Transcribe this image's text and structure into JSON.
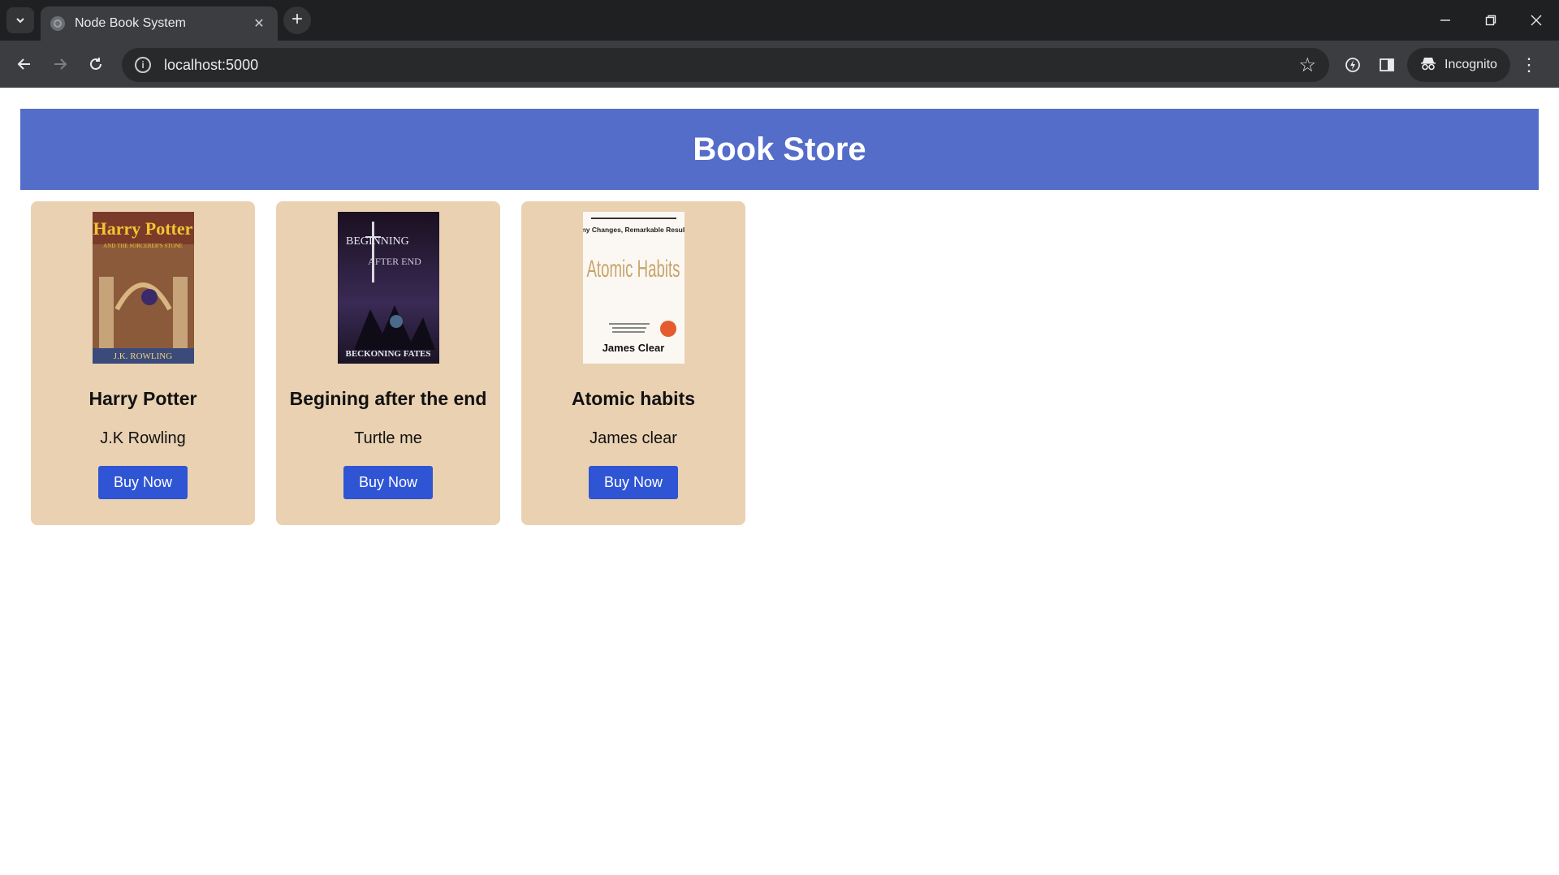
{
  "browser": {
    "tab_title": "Node Book System",
    "url": "localhost:5000",
    "incognito_label": "Incognito"
  },
  "page": {
    "heading": "Book Store",
    "books": [
      {
        "title": "Harry Potter",
        "author": "J.K Rowling",
        "buy_label": "Buy Now",
        "cover_text": {
          "top": "Harry Potter",
          "middle": "AND THE SORCERER'S STONE",
          "bottom": "J.K. ROWLING"
        }
      },
      {
        "title": "Begining after the end",
        "author": "Turtle me",
        "buy_label": "Buy Now",
        "cover_text": {
          "top": "BEGINNING",
          "middle": "AFTER END",
          "bottom": "BECKONING FATES"
        }
      },
      {
        "title": "Atomic habits",
        "author": "James clear",
        "buy_label": "Buy Now",
        "cover_text": {
          "top": "Tiny Changes, Remarkable Results",
          "middle": "Atomic Habits",
          "bottom": "James Clear"
        }
      }
    ]
  },
  "colors": {
    "banner": "#546dc9",
    "card": "#e9d1b2",
    "button": "#2f55d4"
  }
}
